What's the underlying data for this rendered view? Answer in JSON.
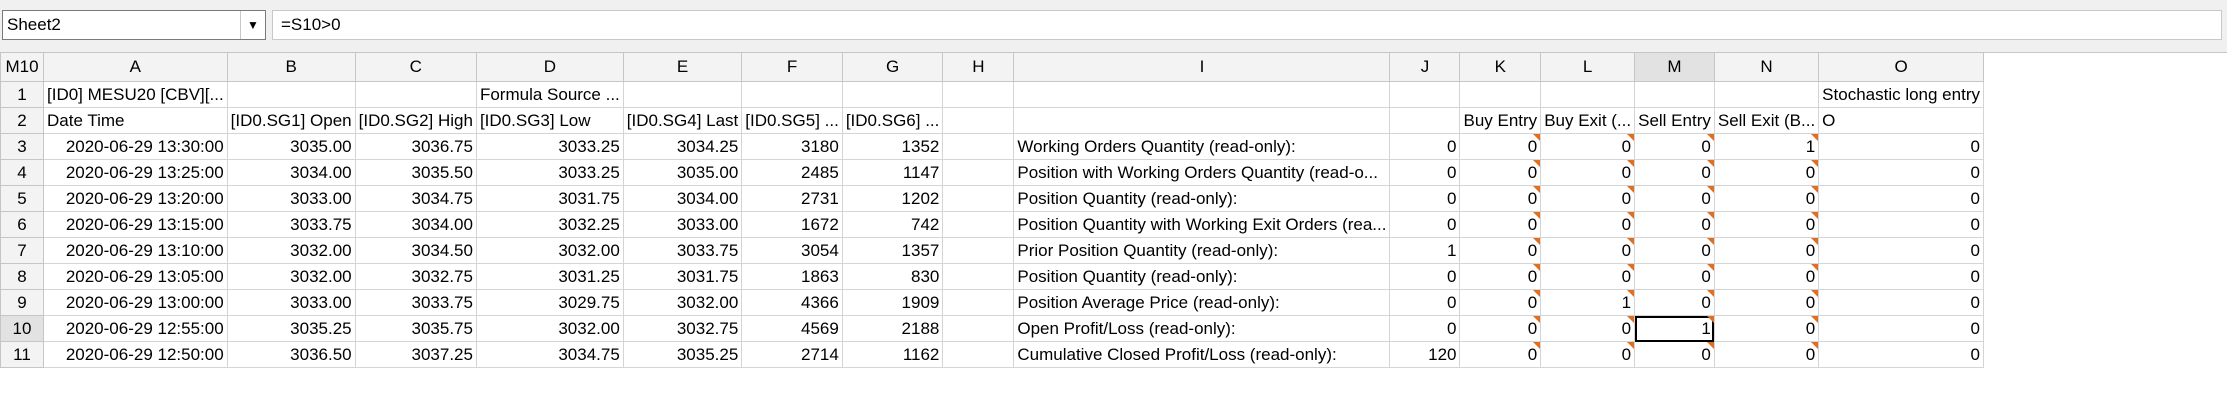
{
  "toolbar": {
    "sheet_name": "Sheet2",
    "formula": "=S10>0"
  },
  "grid": {
    "corner": "M10",
    "columns": [
      "A",
      "B",
      "C",
      "D",
      "E",
      "F",
      "G",
      "H",
      "I",
      "J",
      "K",
      "L",
      "M",
      "N",
      "O"
    ],
    "rows": [
      {
        "n": "1",
        "cells": [
          "[ID0] MESU20 [CBV][...",
          "",
          "",
          "Formula Source ...",
          "",
          "",
          "",
          "",
          "",
          "",
          "",
          "",
          "",
          "",
          "Stochastic long entry"
        ]
      },
      {
        "n": "2",
        "cells": [
          "Date Time",
          "[ID0.SG1] Open",
          "[ID0.SG2] High",
          "[ID0.SG3] Low",
          "[ID0.SG4] Last",
          "[ID0.SG5] ...",
          "[ID0.SG6] ...",
          "",
          "",
          "",
          "Buy Entry",
          "Buy Exit (...",
          "Sell Entry",
          "Sell Exit (B...",
          "O"
        ]
      },
      {
        "n": "3",
        "cells": [
          "2020-06-29  13:30:00",
          "3035.00",
          "3036.75",
          "3033.25",
          "3034.25",
          "3180",
          "1352",
          "",
          "Working Orders Quantity (read-only):",
          "0",
          "0",
          "0",
          "0",
          "1",
          "0"
        ]
      },
      {
        "n": "4",
        "cells": [
          "2020-06-29  13:25:00",
          "3034.00",
          "3035.50",
          "3033.25",
          "3035.00",
          "2485",
          "1147",
          "",
          "Position with Working Orders Quantity (read-o...",
          "0",
          "0",
          "0",
          "0",
          "0",
          "0"
        ]
      },
      {
        "n": "5",
        "cells": [
          "2020-06-29  13:20:00",
          "3033.00",
          "3034.75",
          "3031.75",
          "3034.00",
          "2731",
          "1202",
          "",
          "Position Quantity (read-only):",
          "0",
          "0",
          "0",
          "0",
          "0",
          "0"
        ]
      },
      {
        "n": "6",
        "cells": [
          "2020-06-29  13:15:00",
          "3033.75",
          "3034.00",
          "3032.25",
          "3033.00",
          "1672",
          "742",
          "",
          "Position Quantity with Working Exit Orders (rea...",
          "0",
          "0",
          "0",
          "0",
          "0",
          "0"
        ]
      },
      {
        "n": "7",
        "cells": [
          "2020-06-29  13:10:00",
          "3032.00",
          "3034.50",
          "3032.00",
          "3033.75",
          "3054",
          "1357",
          "",
          "Prior Position Quantity (read-only):",
          "1",
          "0",
          "0",
          "0",
          "0",
          "0"
        ]
      },
      {
        "n": "8",
        "cells": [
          "2020-06-29  13:05:00",
          "3032.00",
          "3032.75",
          "3031.25",
          "3031.75",
          "1863",
          "830",
          "",
          "Position Quantity (read-only):",
          "0",
          "0",
          "0",
          "0",
          "0",
          "0"
        ]
      },
      {
        "n": "9",
        "cells": [
          "2020-06-29  13:00:00",
          "3033.00",
          "3033.75",
          "3029.75",
          "3032.00",
          "4366",
          "1909",
          "",
          "Position Average Price (read-only):",
          "0",
          "0",
          "1",
          "0",
          "0",
          "0"
        ]
      },
      {
        "n": "10",
        "cells": [
          "2020-06-29  12:55:00",
          "3035.25",
          "3035.75",
          "3032.00",
          "3032.75",
          "4569",
          "2188",
          "",
          "Open Profit/Loss (read-only):",
          "0",
          "0",
          "0",
          "1",
          "0",
          "0"
        ]
      },
      {
        "n": "11",
        "cells": [
          "2020-06-29  12:50:00",
          "3036.50",
          "3037.25",
          "3034.75",
          "3035.25",
          "2714",
          "1162",
          "",
          "Cumulative Closed Profit/Loss (read-only):",
          "120",
          "0",
          "0",
          "0",
          "0",
          "0"
        ]
      }
    ]
  }
}
